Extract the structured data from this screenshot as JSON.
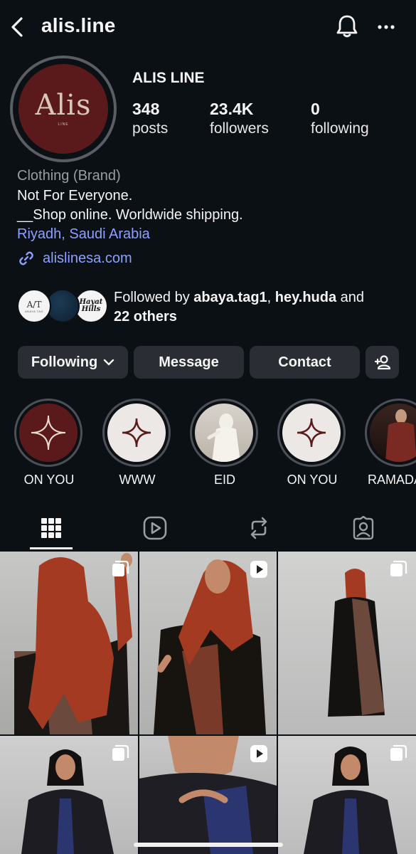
{
  "header": {
    "username": "alis.line",
    "back_icon": "chevron-left-icon",
    "bell_icon": "bell-icon",
    "more_icon": "more-horizontal-icon"
  },
  "profile": {
    "avatar_logo": "Alis",
    "avatar_sub": "LINE",
    "display_name": "ALIS LINE",
    "stats": [
      {
        "value": "348",
        "label": "posts"
      },
      {
        "value": "23.4K",
        "label": "followers"
      },
      {
        "value": "0",
        "label": "following"
      }
    ],
    "category": "Clothing (Brand)",
    "bio_lines": [
      "Not For Everyone.",
      "__Shop online. Worldwide shipping."
    ],
    "location": "Riyadh, Saudi Arabia",
    "website": "alislinesa.com"
  },
  "followed_by": {
    "prefix": "Followed by ",
    "user1": "abaya.tag1",
    "separator": ", ",
    "user2": "hey.huda",
    "conj": " and",
    "others": "22 others",
    "avatar1_text": "A/T",
    "avatar1_sub": "ABAYA TAG",
    "avatar3_text": "Hayat Hills"
  },
  "actions": {
    "following": "Following",
    "message": "Message",
    "contact": "Contact"
  },
  "highlights": [
    {
      "label": "ON YOU"
    },
    {
      "label": "WWW"
    },
    {
      "label": "EID"
    },
    {
      "label": "ON YOU"
    },
    {
      "label": "RAMADA"
    }
  ],
  "tabs": [
    "grid-icon",
    "reels-icon",
    "reposts-icon",
    "tagged-icon"
  ],
  "colors": {
    "background": "#0b1015",
    "button": "#2a2d33",
    "link": "#8ea0ff",
    "brand": "#5a1a1c",
    "scarf": "#a53a22"
  }
}
